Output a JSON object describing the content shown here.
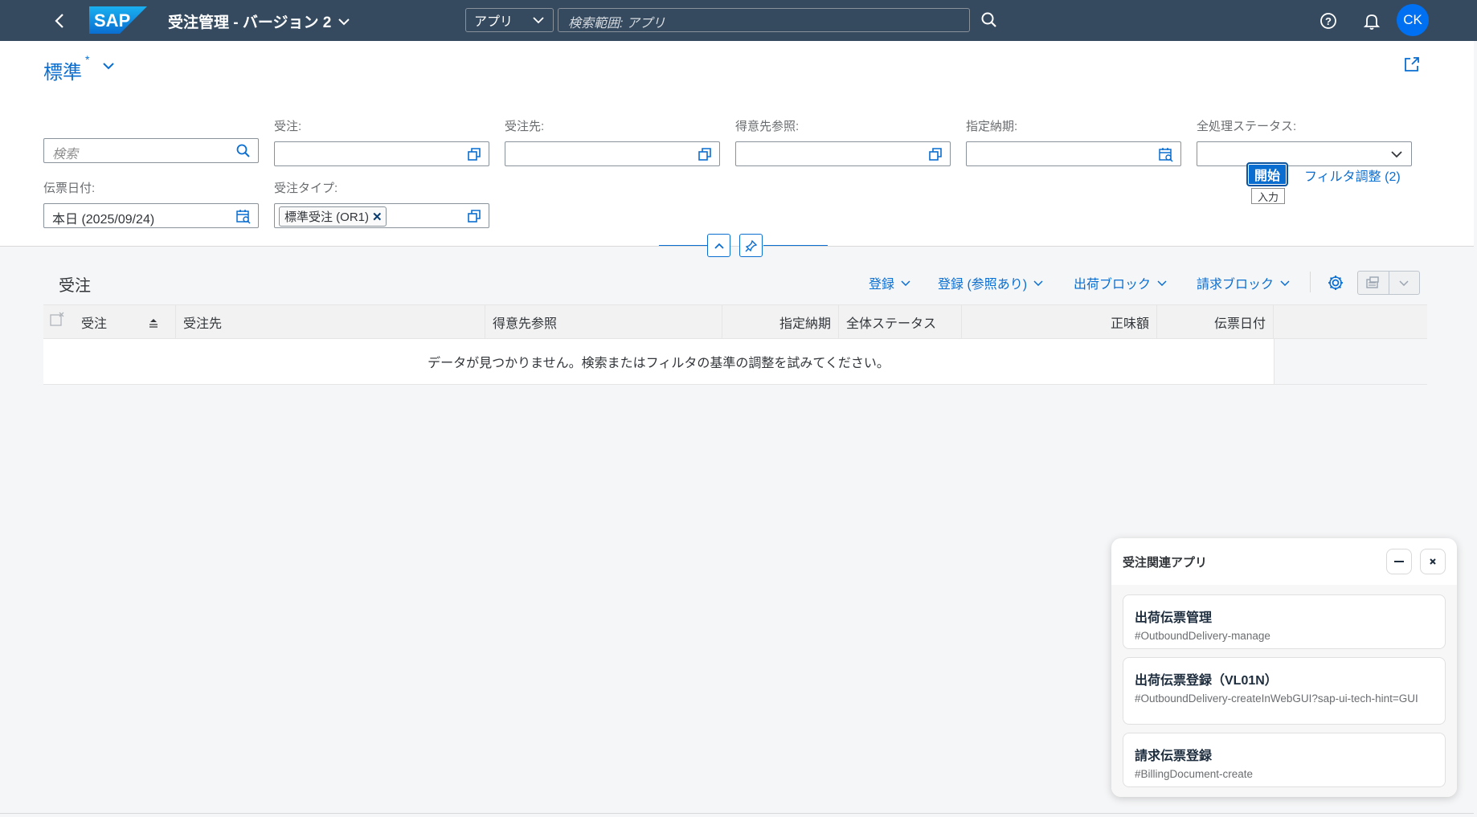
{
  "shell": {
    "logo": "SAP",
    "app_title": "受注管理 - バージョン 2",
    "scope_label": "アプリ",
    "search_placeholder": "検索範囲: アプリ",
    "avatar_initials": "CK"
  },
  "header": {
    "variant_name": "標準",
    "variant_modified_marker": "*"
  },
  "filters": {
    "search_placeholder": "検索",
    "order_label": "受注:",
    "sold_to_label": "受注先:",
    "customer_ref_label": "得意先参照:",
    "requested_delivery_label": "指定納期:",
    "overall_status_label": "全処理ステータス:",
    "doc_date_label": "伝票日付:",
    "doc_date_value": "本日 (2025/09/24)",
    "order_type_label": "受注タイプ:",
    "order_type_token": "標準受注 (OR1)",
    "go_button": "開始",
    "go_tooltip": "入力",
    "adapt_filters": "フィルタ調整 (2)"
  },
  "table": {
    "title": "受注",
    "toolbar": {
      "create": "登録",
      "create_with_ref": "登録 (参照あり)",
      "delivery_block": "出荷ブロック",
      "billing_block": "請求ブロック"
    },
    "columns": [
      "受注",
      "受注先",
      "得意先参照",
      "指定納期",
      "全体ステータス",
      "正味額",
      "伝票日付"
    ],
    "empty_text": "データが見つかりません。検索またはフィルタの基準の調整を試みてください。"
  },
  "related_apps": {
    "title": "受注関連アプリ",
    "items": [
      {
        "title": "出荷伝票管理",
        "hash": "#OutboundDelivery-manage"
      },
      {
        "title": "出荷伝票登録（VL01N）",
        "hash": "#OutboundDelivery-createInWebGUI?sap-ui-tech-hint=GUI"
      },
      {
        "title": "請求伝票登録",
        "hash": "#BillingDocument-create"
      }
    ]
  },
  "colors": {
    "shell_bg": "#354a5f",
    "accent": "#0a6ed1",
    "avatar_bg": "#0070f2"
  }
}
